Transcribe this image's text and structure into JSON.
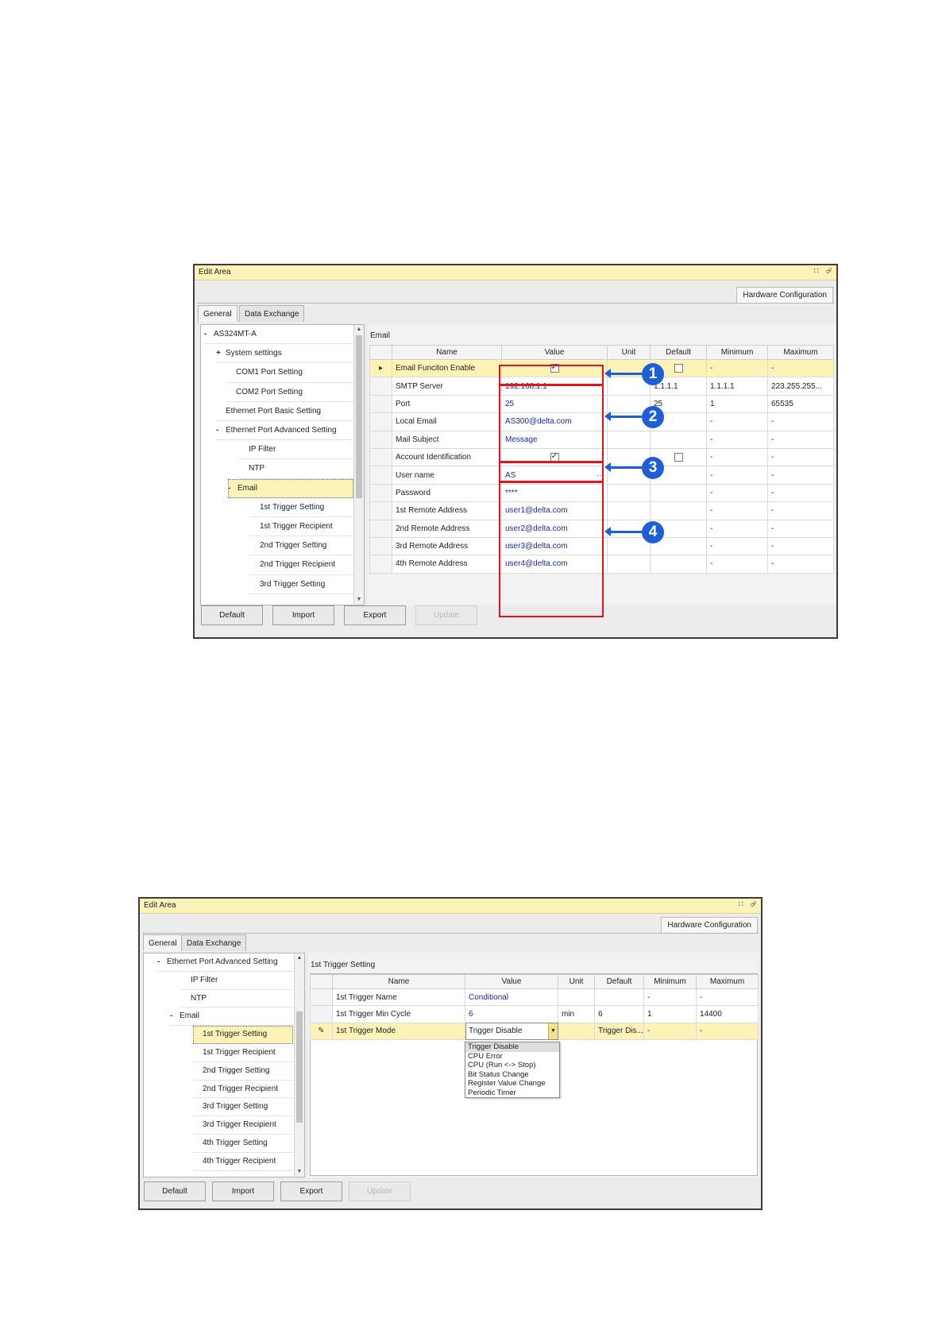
{
  "window1": {
    "title": "Edit Area",
    "title_icons": [
      "pin-icon",
      "float-icon"
    ],
    "doc_tab": "Hardware Configuration",
    "tabs": [
      {
        "label": "General",
        "active": true
      },
      {
        "label": "Data Exchange",
        "active": false
      }
    ],
    "tree": [
      {
        "toggle": "-",
        "label": "AS324MT-A"
      },
      {
        "toggle": "+",
        "label": "System settings"
      },
      {
        "toggle": "",
        "label": "COM1 Port Setting"
      },
      {
        "toggle": "",
        "label": "COM2 Port Setting"
      },
      {
        "toggle": "",
        "label": "Ethernet Port Basic Setting"
      },
      {
        "toggle": "-",
        "label": "Ethernet Port Advanced Setting"
      },
      {
        "toggle": "",
        "label": "IP Filter"
      },
      {
        "toggle": "",
        "label": "NTP"
      },
      {
        "toggle": "-",
        "label": "Email",
        "selected": true
      },
      {
        "toggle": "",
        "label": "1st Trigger Setting"
      },
      {
        "toggle": "",
        "label": "1st Trigger Recipient"
      },
      {
        "toggle": "",
        "label": "2nd Trigger Setting"
      },
      {
        "toggle": "",
        "label": "2nd Trigger Recipient"
      },
      {
        "toggle": "",
        "label": "3rd Trigger Setting"
      }
    ],
    "section_title": "Email",
    "columns": [
      "Name",
      "Value",
      "Unit",
      "Default",
      "Minimum",
      "Maximum"
    ],
    "rows": [
      {
        "indicator": "▸",
        "name": "Email Funciton Enable",
        "value": "",
        "value_checkbox": true,
        "unit": "",
        "default": "",
        "default_checkbox": true,
        "min": "-",
        "max": "-",
        "selected": true
      },
      {
        "indicator": "",
        "name": "SMTP Server",
        "value": "192.168.1.1",
        "unit": "",
        "default": "1.1.1.1",
        "min": "1.1.1.1",
        "max": "223.255.255..."
      },
      {
        "indicator": "",
        "name": "Port",
        "value": "25",
        "unit": "",
        "default": "25",
        "min": "1",
        "max": "65535"
      },
      {
        "indicator": "",
        "name": "Local Email",
        "value": "AS300@delta.com",
        "unit": "",
        "default": "",
        "min": "-",
        "max": "-"
      },
      {
        "indicator": "",
        "name": "Mail Subject",
        "value": "Message",
        "unit": "",
        "default": "",
        "min": "-",
        "max": "-"
      },
      {
        "indicator": "",
        "name": "Account Identification",
        "value": "",
        "value_checkbox": true,
        "unit": "",
        "default": "",
        "default_checkbox": true,
        "min": "-",
        "max": "-"
      },
      {
        "indicator": "",
        "name": "User name",
        "value": "AS",
        "value_suffix": "···",
        "unit": "",
        "default": "",
        "min": "-",
        "max": "-"
      },
      {
        "indicator": "",
        "name": "Password",
        "value": "****",
        "unit": "",
        "default": "",
        "min": "-",
        "max": "-"
      },
      {
        "indicator": "",
        "name": "1st Remote Address",
        "value": "user1@delta.com",
        "unit": "",
        "default": "",
        "min": "-",
        "max": "-"
      },
      {
        "indicator": "",
        "name": "2nd Remote Address",
        "value": "user2@delta.com",
        "unit": "",
        "default": "",
        "min": "-",
        "max": "-"
      },
      {
        "indicator": "",
        "name": "3rd Remote Address",
        "value": "user3@delta.com",
        "unit": "",
        "default": "",
        "min": "-",
        "max": "-"
      },
      {
        "indicator": "",
        "name": "4th Remote Address",
        "value": "user4@delta.com",
        "unit": "",
        "default": "",
        "min": "-",
        "max": "-"
      }
    ],
    "callouts": [
      "1",
      "2",
      "3",
      "4"
    ],
    "buttons": [
      {
        "label": "Default"
      },
      {
        "label": "Import"
      },
      {
        "label": "Export"
      },
      {
        "label": "Update",
        "disabled": true
      }
    ]
  },
  "window2": {
    "title": "Edit Area",
    "title_icons": [
      "pin-icon",
      "float-icon"
    ],
    "doc_tab": "Hardware Configuration",
    "tabs": [
      {
        "label": "General",
        "active": true
      },
      {
        "label": "Data Exchange",
        "active": false
      }
    ],
    "tree": [
      {
        "toggle": "-",
        "label": "Ethernet Port Advanced Setting"
      },
      {
        "toggle": "",
        "label": "IP Filter"
      },
      {
        "toggle": "",
        "label": "NTP"
      },
      {
        "toggle": "-",
        "label": "Email"
      },
      {
        "toggle": "",
        "label": "1st Trigger Setting",
        "selected": true
      },
      {
        "toggle": "",
        "label": "1st Trigger Recipient"
      },
      {
        "toggle": "",
        "label": "2nd Trigger Setting"
      },
      {
        "toggle": "",
        "label": "2nd Trigger Recipient"
      },
      {
        "toggle": "",
        "label": "3rd Trigger Setting"
      },
      {
        "toggle": "",
        "label": "3rd Trigger Recipient"
      },
      {
        "toggle": "",
        "label": "4th Trigger Setting"
      },
      {
        "toggle": "",
        "label": "4th Trigger Recipient"
      }
    ],
    "section_title": "1st Trigger Setting",
    "columns": [
      "Name",
      "Value",
      "Unit",
      "Default",
      "Minimum",
      "Maximum"
    ],
    "rows": [
      {
        "indicator": "",
        "name": "1st Trigger Name",
        "value": "Conditional",
        "unit": "",
        "default": "",
        "min": "-",
        "max": "-"
      },
      {
        "indicator": "",
        "name": "1st Trigger Min Cycle",
        "value": "6",
        "unit": "min",
        "default": "6",
        "min": "1",
        "max": "14400"
      },
      {
        "indicator": "✎",
        "name": "1st Trigger Mode",
        "value": "Trigger Disable",
        "value_dropdown": true,
        "unit": "",
        "default": "Trigger Dis...",
        "min": "-",
        "max": "-",
        "selected": true
      }
    ],
    "dropdown_options": [
      "Trigger Disable",
      "CPU Error",
      "CPU (Run <-> Stop)",
      "Bit Status Change",
      "Register Value Change",
      "Periodic Timer"
    ],
    "dropdown_highlighted": "Trigger Disable",
    "buttons": [
      {
        "label": "Default"
      },
      {
        "label": "Import"
      },
      {
        "label": "Export"
      },
      {
        "label": "Update",
        "disabled": true
      }
    ]
  }
}
